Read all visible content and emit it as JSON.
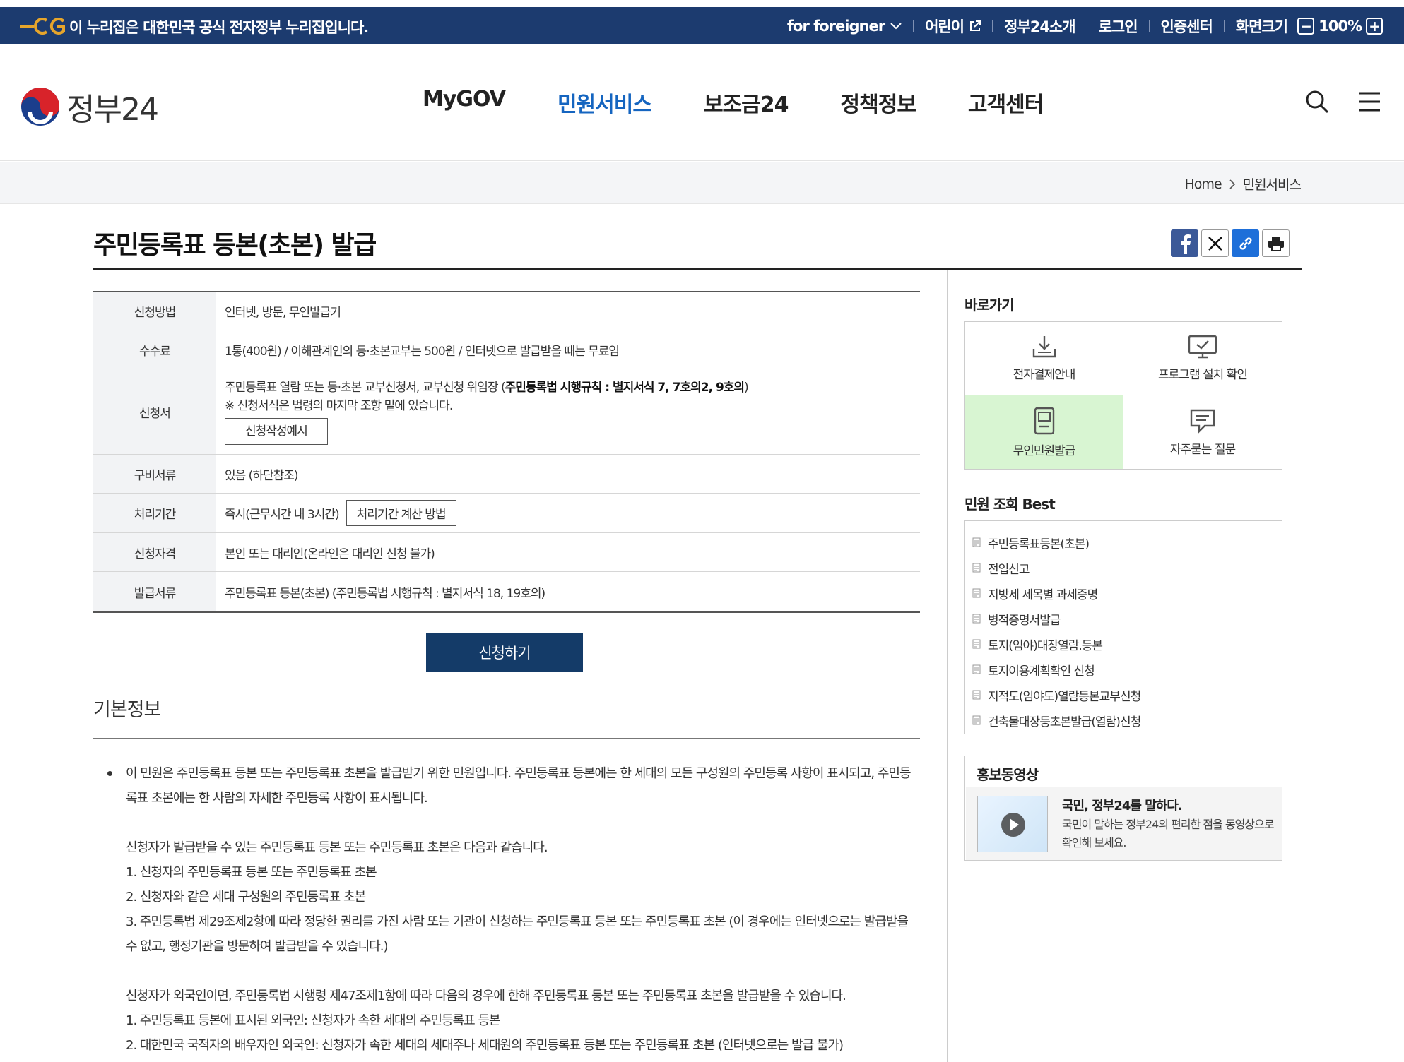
{
  "govbar": {
    "notice": "이 누리집은 대한민국 공식 전자정부 누리집입니다.",
    "links": [
      "for foreigner",
      "어린이",
      "정부24소개",
      "로그인",
      "인증센터",
      "화면크기"
    ],
    "zoom": "100%"
  },
  "header": {
    "brand": "정부24",
    "menu": [
      "MyGOV",
      "민원서비스",
      "보조금24",
      "정책정보",
      "고객센터"
    ],
    "active_menu": "민원서비스"
  },
  "breadcrumb": [
    "Home",
    "민원서비스"
  ],
  "page": {
    "title": "주민등록표 등본(초본) 발급"
  },
  "info": {
    "rows": [
      {
        "label": "신청방법",
        "value": "인터넷, 방문, 무인발급기"
      },
      {
        "label": "수수료",
        "value": "1통(400원) / 이해관계인의 등·초본교부는 500원 / 인터넷으로 발급받을 때는 무료임"
      },
      {
        "label": "신청서",
        "value_prefix": "주민등록표 열람 또는 등·초본 교부신청서, 교부신청 위임장 (",
        "value_bold": "주민등록법 시행규칙 : 별지서식 7, 7호의2, 9호의",
        "value_suffix": ")",
        "note": "※ 신청서식은 법령의 마지막 조항 밑에 있습니다.",
        "button": "신청작성예시"
      },
      {
        "label": "구비서류",
        "value": "있음 (하단참조)"
      },
      {
        "label": "처리기간",
        "value": "즉시(근무시간 내 3시간)",
        "button": "처리기간 계산 방법"
      },
      {
        "label": "신청자격",
        "value": "본인 또는 대리인(온라인은 대리인 신청 불가)"
      },
      {
        "label": "발급서류",
        "value": "주민등록표 등본(초본) (주민등록법 시행규칙 : 별지서식 18, 19호의)"
      }
    ]
  },
  "apply_button": "신청하기",
  "basic": {
    "heading": "기본정보",
    "intro": "이 민원은 주민등록표 등본 또는 주민등록표 초본을 발급받기 위한 민원입니다. 주민등록표 등본에는 한 세대의 모든 구성원의 주민등록 사항이 표시되고, 주민등록표 초본에는 한 사람의 자세한 주민등록 사항이 표시됩니다.",
    "p1": "신청자가 발급받을 수 있는 주민등록표 등본 또는 주민등록표 초본은 다음과 같습니다.",
    "l1": "1. 신청자의 주민등록표 등본 또는 주민등록표 초본",
    "l2": "2. 신청자와 같은 세대 구성원의 주민등록표 초본",
    "l3": "3. 주민등록법 제29조제2항에 따라 정당한 권리를 가진 사람 또는 기관이 신청하는 주민등록표 등본 또는 주민등록표 초본 (이 경우에는 인터넷으로는 발급받을 수 없고, 행정기관을 방문하여 발급받을 수 있습니다.)",
    "p2": "신청자가 외국인이면, 주민등록법 시행령 제47조제1항에 따라 다음의 경우에 한해 주민등록표 등본 또는 주민등록표 초본을 발급받을 수 있습니다.",
    "l4": "1. 주민등록표 등본에 표시된 외국인: 신청자가 속한 세대의 주민등록표 등본",
    "l5": "2. 대한민국 국적자의 배우자인 외국인: 신청자가 속한 세대의 세대주나 세대원의 주민등록표 등본 또는 주민등록표 초본 (인터넷으로는 발급 불가)"
  },
  "sidebar": {
    "quick_title": "바로가기",
    "quick": [
      {
        "label": "전자결제안내",
        "icon": "download-icon"
      },
      {
        "label": "프로그램 설치 확인",
        "icon": "monitor-icon"
      },
      {
        "label": "무인민원발급",
        "icon": "kiosk-icon"
      },
      {
        "label": "자주묻는 질문",
        "icon": "chat-icon"
      }
    ],
    "best_title": "민원 조회 Best",
    "best": [
      "주민등록표등본(초본)",
      "전입신고",
      "지방세 세목별 과세증명",
      "병적증명서발급",
      "토지(임야)대장열람.등본",
      "토지이용계획확인 신청",
      "지적도(임야도)열람등본교부신청",
      "건축물대장등초본발급(열람)신청"
    ],
    "promo_title": "홍보동영상",
    "promo_heading": "국민, 정부24를 말하다.",
    "promo_desc": "국민이 말하는 정부24의 편리한 점을 동영상으로 확인해 보세요."
  }
}
